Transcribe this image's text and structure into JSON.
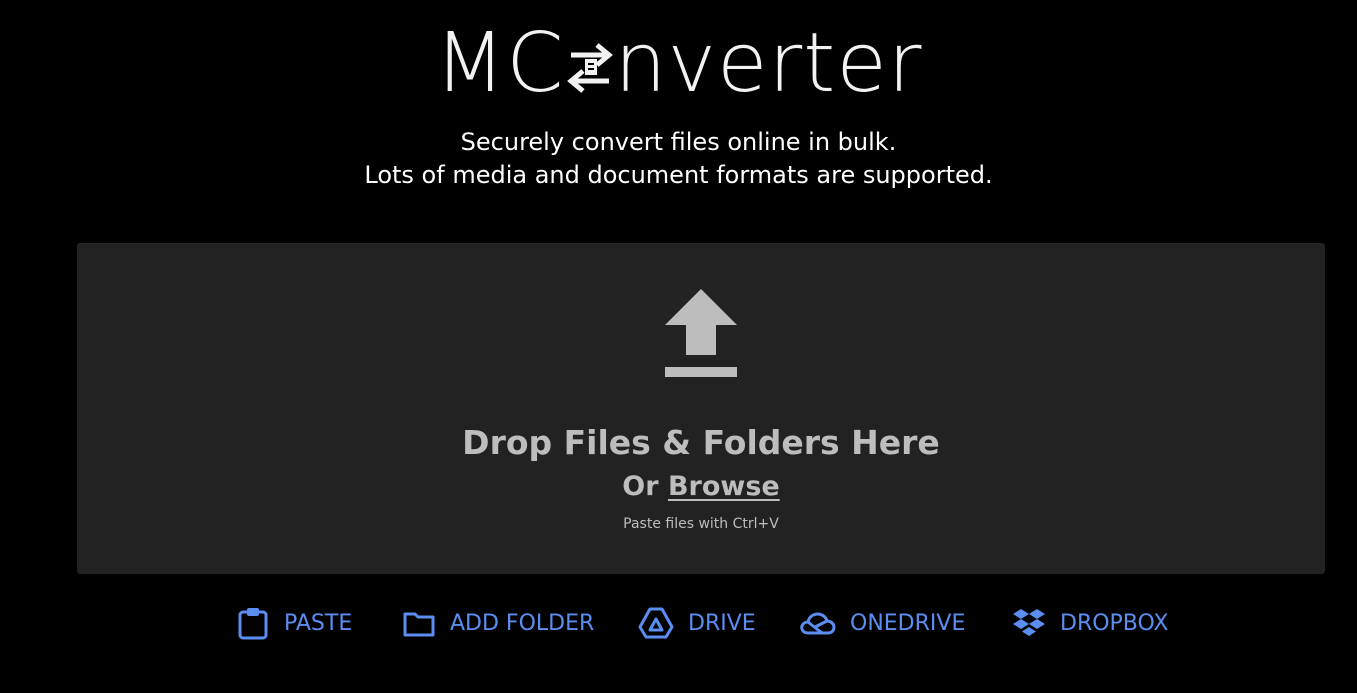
{
  "logo": {
    "text_before": "MC",
    "icon": "convert-arrows-icon",
    "text_after": "nverter"
  },
  "tagline": {
    "line1": "Securely convert files online in bulk.",
    "line2": "Lots of media and document formats are supported."
  },
  "dropzone": {
    "icon": "upload-icon",
    "title": "Drop Files & Folders Here",
    "or_prefix": "Or ",
    "browse_label": "Browse",
    "paste_hint": "Paste files with Ctrl+V"
  },
  "actions": [
    {
      "icon": "clipboard-icon",
      "label": "PASTE"
    },
    {
      "icon": "folder-icon",
      "label": "ADD FOLDER"
    },
    {
      "icon": "google-drive-icon",
      "label": "DRIVE"
    },
    {
      "icon": "onedrive-icon",
      "label": "ONEDRIVE"
    },
    {
      "icon": "dropbox-icon",
      "label": "DROPBOX"
    }
  ],
  "colors": {
    "background": "#000000",
    "dropzone_bg": "#222222",
    "dropzone_text": "#bdbdbd",
    "accent": "#5c8ef2"
  }
}
